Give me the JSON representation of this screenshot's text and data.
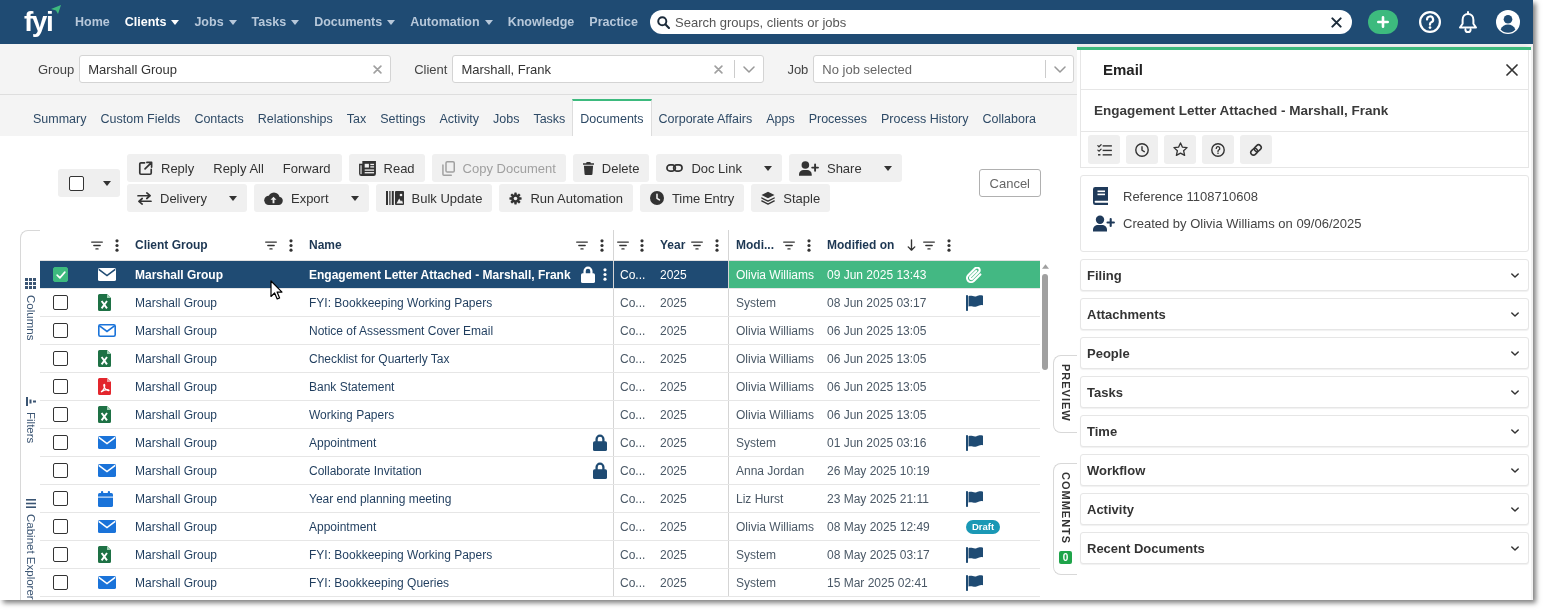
{
  "nav": {
    "logo": "fyi",
    "items": [
      {
        "label": "Home",
        "selected": false,
        "dropdown": false
      },
      {
        "label": "Clients",
        "selected": true,
        "dropdown": true
      },
      {
        "label": "Jobs",
        "selected": false,
        "dropdown": true
      },
      {
        "label": "Tasks",
        "selected": false,
        "dropdown": true
      },
      {
        "label": "Documents",
        "selected": false,
        "dropdown": true
      },
      {
        "label": "Automation",
        "selected": false,
        "dropdown": true
      },
      {
        "label": "Knowledge",
        "selected": false,
        "dropdown": false
      },
      {
        "label": "Practice",
        "selected": false,
        "dropdown": false
      }
    ],
    "search": {
      "placeholder": "Search groups, clients or jobs"
    }
  },
  "context": [
    {
      "label": "Group",
      "value": "Marshall Group",
      "dropdown": false
    },
    {
      "label": "Client",
      "value": "Marshall, Frank",
      "dropdown": true
    },
    {
      "label": "Job",
      "placeholder": "No job selected",
      "dropdown": true
    }
  ],
  "tabs": [
    {
      "label": "Summary",
      "selected": false
    },
    {
      "label": "Custom Fields",
      "selected": false
    },
    {
      "label": "Contacts",
      "selected": false
    },
    {
      "label": "Relationships",
      "selected": false
    },
    {
      "label": "Tax",
      "selected": false
    },
    {
      "label": "Settings",
      "selected": false
    },
    {
      "label": "Activity",
      "selected": false
    },
    {
      "label": "Jobs",
      "selected": false
    },
    {
      "label": "Tasks",
      "selected": false
    },
    {
      "label": "Documents",
      "selected": true
    },
    {
      "label": "Corporate Affairs",
      "selected": false
    },
    {
      "label": "Apps",
      "selected": false
    },
    {
      "label": "Processes",
      "selected": false
    },
    {
      "label": "Process History",
      "selected": false
    },
    {
      "label": "Collabora",
      "selected": false
    }
  ],
  "toolbar": {
    "select_all": {
      "checked": false
    },
    "groups": [
      {
        "buttons": [
          {
            "label": "Reply",
            "disabled": false,
            "dropdown": false
          },
          {
            "label": "Reply All",
            "disabled": false,
            "dropdown": false
          },
          {
            "label": "Forward",
            "disabled": false,
            "dropdown": false
          }
        ]
      },
      {
        "buttons": [
          {
            "label": "Read",
            "disabled": false,
            "dropdown": false
          }
        ]
      },
      {
        "buttons": [
          {
            "label": "Copy Document",
            "disabled": true,
            "dropdown": false
          }
        ]
      },
      {
        "buttons": [
          {
            "label": "Delete",
            "disabled": false,
            "dropdown": false
          }
        ]
      },
      {
        "buttons": [
          {
            "label": "Doc Link",
            "disabled": false,
            "dropdown": true
          }
        ]
      },
      {
        "buttons": [
          {
            "label": "Share",
            "disabled": false,
            "dropdown": true
          }
        ]
      },
      {
        "buttons": [
          {
            "label": "Delivery",
            "disabled": false,
            "dropdown": true
          }
        ]
      },
      {
        "buttons": [
          {
            "label": "Export",
            "disabled": false,
            "dropdown": true
          }
        ]
      },
      {
        "buttons": [
          {
            "label": "Bulk Update",
            "disabled": false,
            "dropdown": false
          }
        ]
      },
      {
        "buttons": [
          {
            "label": "Run Automation",
            "disabled": false,
            "dropdown": false
          }
        ]
      },
      {
        "buttons": [
          {
            "label": "Time Entry",
            "disabled": false,
            "dropdown": false
          }
        ]
      },
      {
        "buttons": [
          {
            "label": "Staple",
            "disabled": false,
            "dropdown": false
          }
        ]
      }
    ],
    "cancel": "Cancel"
  },
  "side_tabs": [
    {
      "label": "Columns"
    },
    {
      "label": "Filters"
    },
    {
      "label": "Cabinet Explorer"
    }
  ],
  "table": {
    "columns": [
      {},
      {
        "label": "Client Group"
      },
      {
        "label": "Name"
      },
      {},
      {
        "label": "Year"
      },
      {
        "label": "Modi..."
      },
      {
        "label": "Modified on",
        "sorted_descending": true
      }
    ],
    "rows": [
      {
        "selected": true,
        "checked": true,
        "kind": "email",
        "client_group": "Marshall Group",
        "name": "Engagement Letter Attached - Marshall, Frank",
        "locked": true,
        "column_5": "Co...",
        "year": "2025",
        "column_7": "Olivia Williams",
        "modified_on": "09 Jun 2025 13:43",
        "attached": true,
        "flagged": false
      },
      {
        "selected": false,
        "checked": false,
        "kind": "spreadsheet",
        "client_group": "Marshall Group",
        "name": "FYI: Bookkeeping Working Papers",
        "locked": false,
        "column_5": "Co...",
        "year": "2025",
        "column_7": "System",
        "modified_on": "08 Jun 2025 03:17",
        "attached": false,
        "flagged": true
      },
      {
        "selected": false,
        "checked": false,
        "kind": "email-outline",
        "client_group": "Marshall Group",
        "name": "Notice of Assessment Cover Email",
        "locked": false,
        "column_5": "Co...",
        "year": "2025",
        "column_7": "Olivia Williams",
        "modified_on": "06 Jun 2025 13:05",
        "attached": false,
        "flagged": false
      },
      {
        "selected": false,
        "checked": false,
        "kind": "spreadsheet",
        "client_group": "Marshall Group",
        "name": "Checklist for Quarterly Tax",
        "locked": false,
        "column_5": "Co...",
        "year": "2025",
        "column_7": "Olivia Williams",
        "modified_on": "06 Jun 2025 13:05",
        "attached": false,
        "flagged": false
      },
      {
        "selected": false,
        "checked": false,
        "kind": "pdf",
        "client_group": "Marshall Group",
        "name": "Bank Statement",
        "locked": false,
        "column_5": "Co...",
        "year": "2025",
        "column_7": "Olivia Williams",
        "modified_on": "06 Jun 2025 13:05",
        "attached": false,
        "flagged": false
      },
      {
        "selected": false,
        "checked": false,
        "kind": "spreadsheet",
        "client_group": "Marshall Group",
        "name": "Working Papers",
        "locked": false,
        "column_5": "Co...",
        "year": "2025",
        "column_7": "Olivia Williams",
        "modified_on": "06 Jun 2025 13:05",
        "attached": false,
        "flagged": false
      },
      {
        "selected": false,
        "checked": false,
        "kind": "email",
        "client_group": "Marshall Group",
        "name": "Appointment",
        "locked": true,
        "column_5": "Co...",
        "year": "2025",
        "column_7": "System",
        "modified_on": "01 Jun 2025 03:16",
        "attached": false,
        "flagged": true
      },
      {
        "selected": false,
        "checked": false,
        "kind": "email",
        "client_group": "Marshall Group",
        "name": "Collaborate Invitation",
        "locked": true,
        "column_5": "Co...",
        "year": "2025",
        "column_7": "Anna Jordan",
        "modified_on": "26 May 2025 10:19",
        "attached": false,
        "flagged": false
      },
      {
        "selected": false,
        "checked": false,
        "kind": "calendar",
        "client_group": "Marshall Group",
        "name": "Year end planning meeting",
        "locked": false,
        "column_5": "Co...",
        "year": "2025",
        "column_7": "Liz Hurst",
        "modified_on": "23 May 2025 21:11",
        "attached": false,
        "flagged": true
      },
      {
        "selected": false,
        "checked": false,
        "kind": "email",
        "client_group": "Marshall Group",
        "name": "Appointment",
        "locked": false,
        "column_5": "Co...",
        "year": "2025",
        "column_7": "Olivia Williams",
        "modified_on": "08 May 2025 12:49",
        "attached": false,
        "flagged": false,
        "badge": "Draft"
      },
      {
        "selected": false,
        "checked": false,
        "kind": "spreadsheet",
        "client_group": "Marshall Group",
        "name": "FYI: Bookkeeping Working Papers",
        "locked": false,
        "column_5": "Co...",
        "year": "2025",
        "column_7": "System",
        "modified_on": "08 May 2025 03:17",
        "attached": false,
        "flagged": true
      },
      {
        "selected": false,
        "checked": false,
        "kind": "email",
        "client_group": "Marshall Group",
        "name": "FYI: Bookkeeping Queries",
        "locked": false,
        "column_5": "Co...",
        "year": "2025",
        "column_7": "System",
        "modified_on": "15 Mar 2025 02:41",
        "attached": false,
        "flagged": true
      }
    ]
  },
  "preview_tabs": [
    {
      "label": "PREVIEW"
    },
    {
      "label": "COMMENTS",
      "count": "0"
    }
  ],
  "panel": {
    "title": "Email",
    "subject": "Engagement Letter Attached - Marshall, Frank",
    "details": [
      "Reference 1108710608",
      "Created by Olivia Williams on 09/06/2025"
    ],
    "sections": [
      {
        "label": "Filing",
        "expanded": false
      },
      {
        "label": "Attachments",
        "expanded": false
      },
      {
        "label": "People",
        "expanded": false
      },
      {
        "label": "Tasks",
        "expanded": false
      },
      {
        "label": "Time",
        "expanded": false
      },
      {
        "label": "Workflow",
        "expanded": false
      },
      {
        "label": "Activity",
        "expanded": false
      },
      {
        "label": "Recent Documents",
        "expanded": false
      }
    ]
  }
}
